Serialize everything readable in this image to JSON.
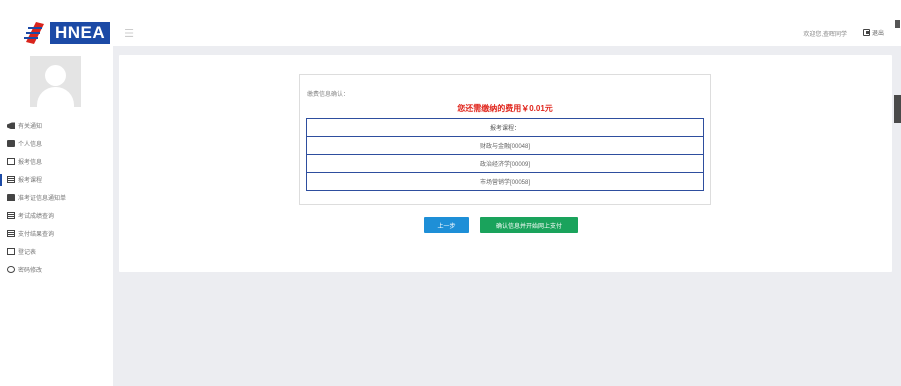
{
  "header": {
    "logo_text": "HNEA",
    "welcome_text": "欢迎您,查晖同学",
    "logout_label": "退出"
  },
  "sidebar": {
    "items": [
      {
        "label": "有关通知",
        "icon": "bullhorn-icon"
      },
      {
        "label": "个人信息",
        "icon": "comment-icon"
      },
      {
        "label": "报考信息",
        "icon": "monitor-icon"
      },
      {
        "label": "报考课程",
        "icon": "document-icon",
        "active": true
      },
      {
        "label": "准考证信息通知单",
        "icon": "print-icon"
      },
      {
        "label": "考试成绩查询",
        "icon": "list-icon"
      },
      {
        "label": "支付结果查询",
        "icon": "document-icon"
      },
      {
        "label": "登记表",
        "icon": "edit-icon"
      },
      {
        "label": "密码修改",
        "icon": "at-icon"
      }
    ]
  },
  "confirm": {
    "title": "缴费信息确认：",
    "fee_text": "您还需缴纳的费用￥0.01元",
    "table_header": "报考课程：",
    "courses": [
      "财政与金融[00048]",
      "政治经济学[00009]",
      "市场营销学[00058]"
    ]
  },
  "buttons": {
    "prev_label": "上一步",
    "pay_label": "确认信息并开始网上支付"
  },
  "colors": {
    "brand": "#1c4aa6",
    "fee_red": "#e0241b",
    "prev_blue": "#1e8fd7",
    "pay_green": "#1aa35c",
    "table_border": "#2e4e9e"
  }
}
